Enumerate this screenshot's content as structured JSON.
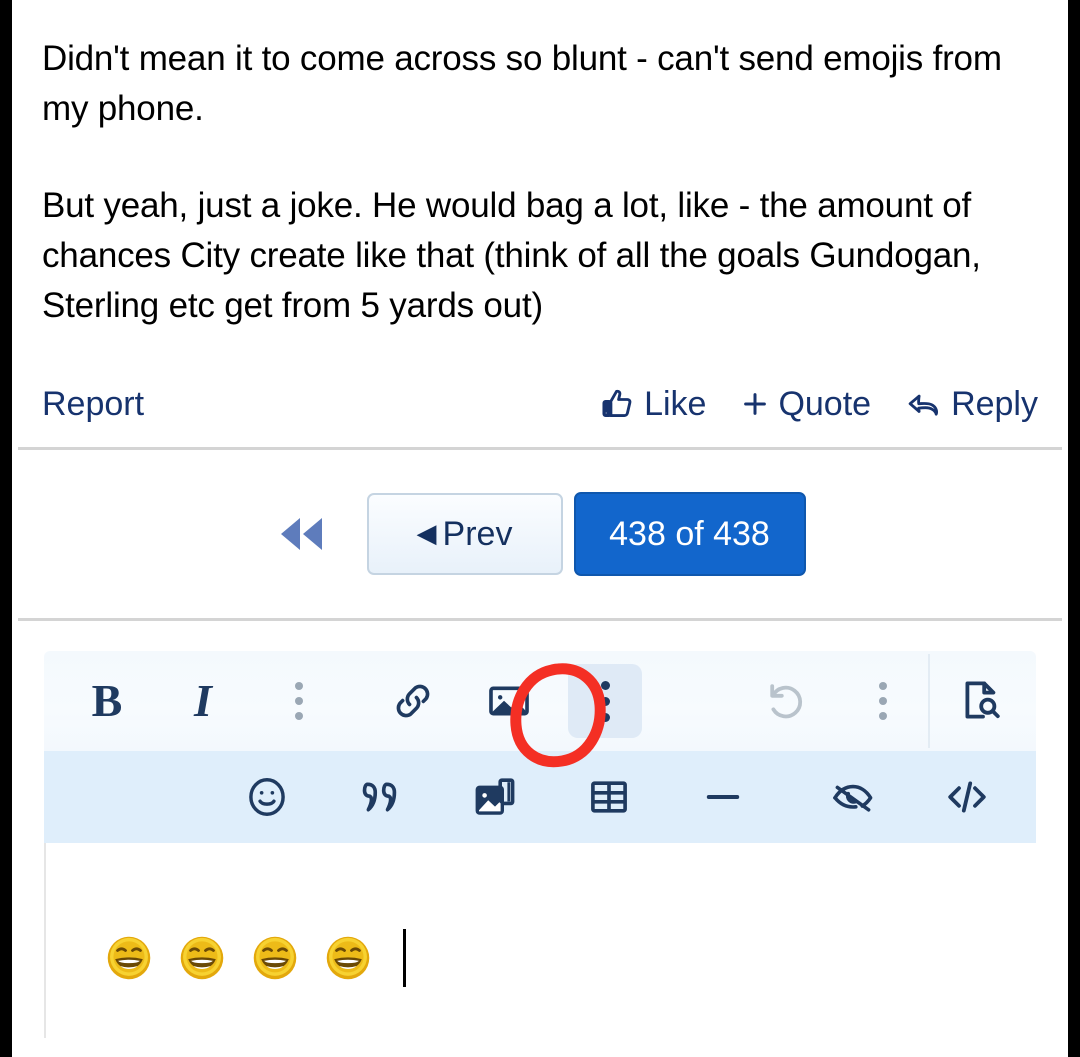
{
  "post": {
    "paragraphs": [
      "Didn't mean it to come across so blunt - can't send emojis from my phone.",
      "But yeah, just a joke. He would bag a lot, like - the amount of chances City create like that (think of all the goals Gundogan, Sterling etc get from 5 yards out)"
    ]
  },
  "actions": {
    "report": "Report",
    "like": "Like",
    "quote": "Quote",
    "quote_prefix": "+",
    "reply": "Reply",
    "link_color": "#17336e"
  },
  "pagination": {
    "rewind_icon": "rewind-double-left-icon",
    "prev_label": "Prev",
    "prev_caret": "◀",
    "count_label": "438 of 438",
    "current_page": 438,
    "total_pages": 438,
    "active_color": "#1266cc"
  },
  "editor": {
    "toolbar_row1": [
      {
        "name": "bold-button",
        "label": "B",
        "kind": "text"
      },
      {
        "name": "italic-button",
        "label": "I",
        "kind": "text"
      },
      {
        "name": "more-format-options-button",
        "label": "",
        "kind": "dots-grey"
      },
      {
        "name": "insert-link-button",
        "label": "",
        "kind": "icon"
      },
      {
        "name": "insert-image-button",
        "label": "",
        "kind": "icon"
      },
      {
        "name": "more-insert-options-button",
        "label": "",
        "kind": "dots-dark-highlighted"
      },
      {
        "name": "undo-button",
        "label": "",
        "kind": "icon-disabled"
      },
      {
        "name": "more-history-options-button",
        "label": "",
        "kind": "dots-grey"
      },
      {
        "name": "preview-button",
        "label": "",
        "kind": "icon"
      }
    ],
    "toolbar_row2": [
      {
        "name": "emoji-button",
        "label": ""
      },
      {
        "name": "quote-block-button",
        "label": ""
      },
      {
        "name": "media-gallery-button",
        "label": ""
      },
      {
        "name": "insert-table-button",
        "label": ""
      },
      {
        "name": "horizontal-rule-button",
        "label": ""
      },
      {
        "name": "spoiler-button",
        "label": ""
      },
      {
        "name": "code-button",
        "label": ""
      }
    ],
    "annotation": {
      "shape": "hand-drawn-circle",
      "color": "#f42f24",
      "targets": "more-insert-options-button"
    },
    "compose": {
      "emoji_count": 4,
      "emoji_name": "grinning-laughing-emoji",
      "cursor_visible": true
    }
  },
  "colors": {
    "page_background": "#ffffff",
    "frame_border": "#000000",
    "toolbar_row1_bg": "#f5fafe",
    "toolbar_row2_bg": "#dfeefb",
    "divider": "#d4d4d4",
    "icon_navy": "#1f3a60",
    "icon_grey": "#9aa7b4",
    "emoji_yellow": "#f2c21c"
  }
}
